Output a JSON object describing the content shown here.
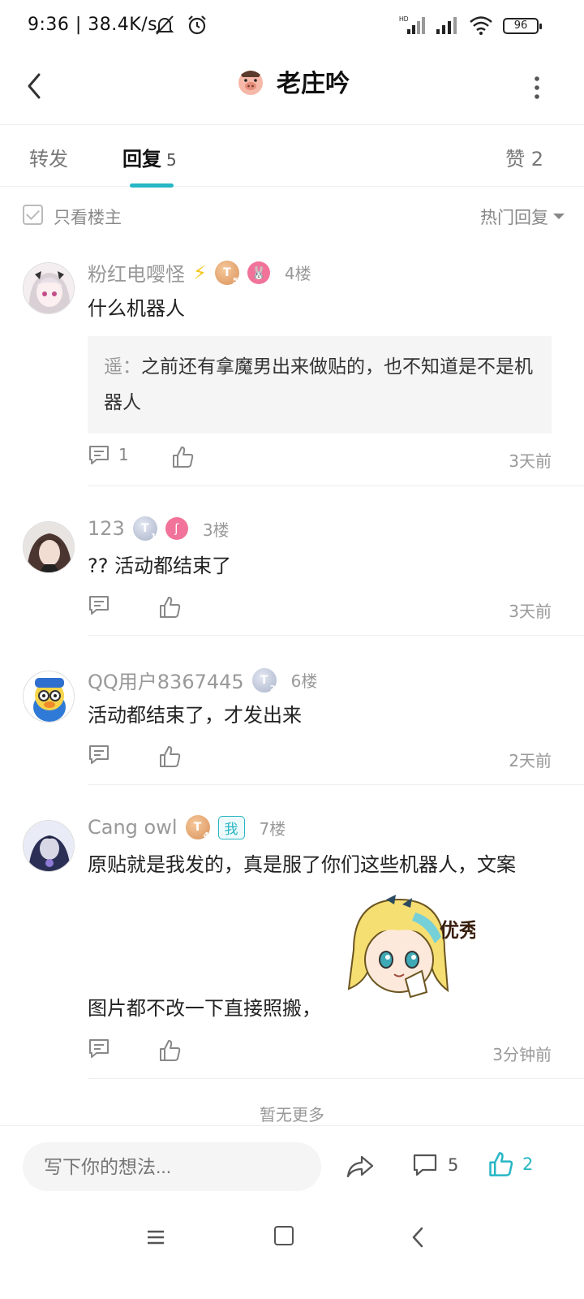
{
  "status_bar": {
    "time": "9:36 | 38.4K/s",
    "battery": "96"
  },
  "header": {
    "title": "老庄吟"
  },
  "tabs": {
    "repost": "转发",
    "reply": "回复",
    "reply_count": "5",
    "likes": "赞 2"
  },
  "filter": {
    "only_op": "只看楼主",
    "sort": "热门回复"
  },
  "comments": [
    {
      "user": "粉红电嘤怪",
      "level": "T",
      "level_num": "5",
      "floor": "4楼",
      "text": "什么机器人",
      "quote_name": "遥",
      "quote_sep": "：",
      "quote_text": "之前还有拿魔男出来做贴的，也不知道是不是机器人",
      "reply_count": "1",
      "time": "3天前"
    },
    {
      "user": "123",
      "level": "T",
      "level_num": "1",
      "floor": "3楼",
      "text": "?? 活动都结束了",
      "time": "3天前"
    },
    {
      "user": "QQ用户8367445",
      "level": "T",
      "level_num": "2",
      "floor": "6楼",
      "text": "活动都结束了，才发出来",
      "time": "2天前"
    },
    {
      "user": "Cang owl",
      "level": "T",
      "level_num": "4",
      "me_tag": "我",
      "floor": "7楼",
      "text": "原贴就是我发的，真是服了你们这些机器人，文案",
      "text2": "图片都不改一下直接照搬，",
      "sticker_text": "优秀",
      "time": "3分钟前"
    }
  ],
  "no_more": "暂无更多",
  "input_bar": {
    "placeholder": "写下你的想法...",
    "comment_count": "5",
    "like_count": "2"
  },
  "colors": {
    "accent": "#27b6c4",
    "text": "#222222",
    "muted": "#999999"
  }
}
